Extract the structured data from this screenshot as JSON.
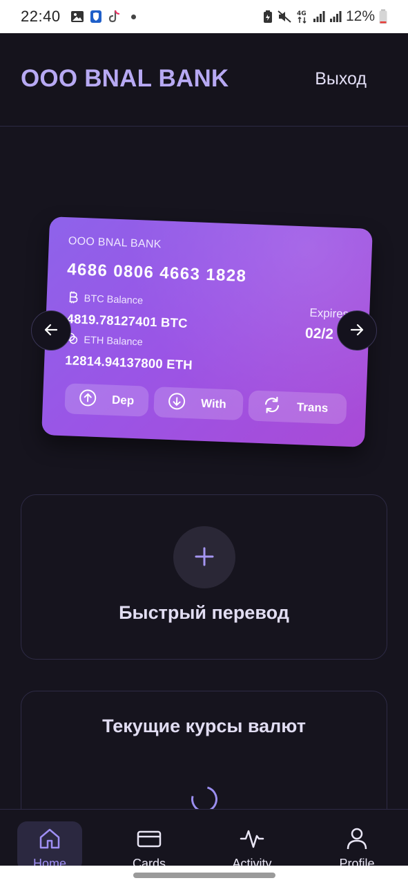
{
  "status_bar": {
    "time": "22:40",
    "battery": "12%",
    "network": "4G",
    "icons_left": [
      "gallery-icon",
      "shield-app-icon",
      "tiktok-icon",
      "dot-icon"
    ],
    "icons_right": [
      "battery-saver-icon",
      "mute-icon",
      "network-4g-icon",
      "signal-icon",
      "signal-icon",
      "battery-icon"
    ]
  },
  "header": {
    "brand": "OOO BNAL BANK",
    "logout_label": "Выход"
  },
  "card": {
    "bank": "OOO BNAL BANK",
    "number": "4686 0806 4663 1828",
    "btc_label": "BTC Balance",
    "btc_value": "4819.78127401 BTC",
    "eth_label": "ETH Balance",
    "eth_value": "12814.94137800 ETH",
    "expires_label": "Expires",
    "expires_value": "02/2",
    "actions": [
      {
        "label": "Dep",
        "icon": "arrow-up-circle-icon"
      },
      {
        "label": "With",
        "icon": "arrow-down-circle-icon"
      },
      {
        "label": "Trans",
        "icon": "refresh-icon"
      }
    ],
    "colors": {
      "gradient_start": "#8e63ea",
      "gradient_end": "#a94ad6"
    }
  },
  "carousel": {
    "prev_icon": "arrow-left-icon",
    "next_icon": "arrow-right-icon"
  },
  "quick_transfer": {
    "icon": "plus-icon",
    "title": "Быстрый перевод"
  },
  "rates": {
    "title": "Текущие курсы валют",
    "loading_icon": "spinner-icon"
  },
  "nav": {
    "items": [
      {
        "label": "Home",
        "icon": "home-icon",
        "active": true
      },
      {
        "label": "Cards",
        "icon": "card-icon",
        "active": false
      },
      {
        "label": "Activity",
        "icon": "activity-icon",
        "active": false
      },
      {
        "label": "Profile",
        "icon": "user-icon",
        "active": false
      }
    ]
  },
  "theme": {
    "background": "#16141e",
    "accent": "#9f8ff4",
    "brand_color": "#b7a9f3"
  }
}
